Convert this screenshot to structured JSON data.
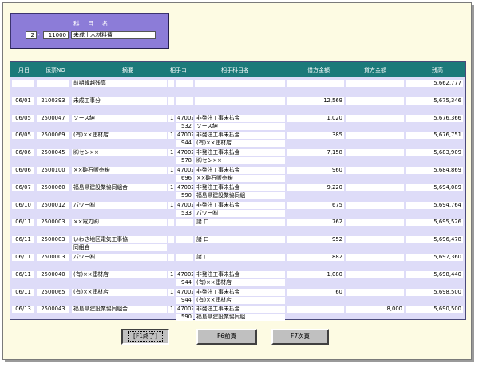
{
  "account": {
    "title": "科 目 名",
    "code1": "2",
    "code2": "11000",
    "name": "未成土木材料費"
  },
  "columns": {
    "date": "月日",
    "slip": "伝票NO",
    "summary": "摘要",
    "counter_code": "相手コ",
    "counter_name": "相手科目名",
    "debit": "借方金額",
    "credit": "貸方金額",
    "balance": "残高"
  },
  "rows": [
    {
      "date": "",
      "slip": "",
      "summary": "前期繰越残高",
      "summary2": "",
      "num": "",
      "code": "",
      "code2": "",
      "name": "",
      "name2": "",
      "debit": "",
      "credit": "",
      "balance": "5,662,777"
    },
    {
      "date": "06/01",
      "slip": "2100393",
      "summary": "未成工事分",
      "summary2": "",
      "num": "",
      "code": "",
      "code2": "",
      "name": "",
      "name2": "",
      "debit": "12,569",
      "credit": "",
      "balance": "5,675,346"
    },
    {
      "date": "06/05",
      "slip": "2500047",
      "summary": "ソース紳",
      "summary2": "",
      "num": "1",
      "code": "47002",
      "code2": "532",
      "name": "非発注工事未払金",
      "name2": "ソース紳",
      "debit": "1,020",
      "credit": "",
      "balance": "5,676,366"
    },
    {
      "date": "06/05",
      "slip": "2500069",
      "summary": "(有)××建材店",
      "summary2": "",
      "num": "1",
      "code": "47002",
      "code2": "944",
      "name": "非発注工事未払金",
      "name2": "(有)××建材店",
      "debit": "385",
      "credit": "",
      "balance": "5,676,751"
    },
    {
      "date": "06/06",
      "slip": "2500045",
      "summary": "㈱セン××",
      "summary2": "",
      "num": "1",
      "code": "47002",
      "code2": "578",
      "name": "非発注工事未払金",
      "name2": "㈱セン××",
      "debit": "7,158",
      "credit": "",
      "balance": "5,683,909"
    },
    {
      "date": "06/06",
      "slip": "2500100",
      "summary": "××砕石販売㈱",
      "summary2": "",
      "num": "1",
      "code": "47002",
      "code2": "696",
      "name": "非発注工事未払金",
      "name2": "××砕石販売㈱",
      "debit": "960",
      "credit": "",
      "balance": "5,684,869"
    },
    {
      "date": "06/07",
      "slip": "2500060",
      "summary": "福島県建設業協同組合",
      "summary2": "",
      "num": "1",
      "code": "47002",
      "code2": "590",
      "name": "非発注工事未払金",
      "name2": "福島県建設業協同組",
      "debit": "9,220",
      "credit": "",
      "balance": "5,694,089"
    },
    {
      "date": "06/10",
      "slip": "2500012",
      "summary": "パワー㈱",
      "summary2": "",
      "num": "1",
      "code": "47002",
      "code2": "533",
      "name": "非発注工事未払金",
      "name2": "パワー㈱",
      "debit": "675",
      "credit": "",
      "balance": "5,694,764"
    },
    {
      "date": "06/11",
      "slip": "2500003",
      "summary": "××電力㈱",
      "summary2": "",
      "num": "",
      "code": "",
      "code2": "",
      "name": "諸 口",
      "name2": "",
      "debit": "762",
      "credit": "",
      "balance": "5,695,526"
    },
    {
      "date": "06/11",
      "slip": "2500003",
      "summary": "いわき地区電気工事協",
      "summary2": "同組合",
      "num": "",
      "code": "",
      "code2": "",
      "name": "諸 口",
      "name2": "",
      "debit": "952",
      "credit": "",
      "balance": "5,696,478"
    },
    {
      "date": "06/11",
      "slip": "2500003",
      "summary": "パワー㈱",
      "summary2": "",
      "num": "",
      "code": "",
      "code2": "",
      "name": "諸 口",
      "name2": "",
      "debit": "882",
      "credit": "",
      "balance": "5,697,360"
    },
    {
      "date": "06/11",
      "slip": "2500040",
      "summary": "(有)××建材店",
      "summary2": "",
      "num": "1",
      "code": "47002",
      "code2": "944",
      "name": "非発注工事未払金",
      "name2": "(有)××建材店",
      "debit": "1,080",
      "credit": "",
      "balance": "5,698,440"
    },
    {
      "date": "06/11",
      "slip": "2500065",
      "summary": "(有)××建材店",
      "summary2": "",
      "num": "1",
      "code": "47002",
      "code2": "944",
      "name": "非発注工事未払金",
      "name2": "(有)××建材店",
      "debit": "60",
      "credit": "",
      "balance": "5,698,500"
    },
    {
      "date": "06/13",
      "slip": "2500043",
      "summary": "福島県建設業協同組合",
      "summary2": "",
      "num": "1",
      "code": "47002",
      "code2": "590",
      "name": "非発注工事未払金",
      "name2": "福島県建設業協同組",
      "debit": "",
      "credit": "8,000",
      "balance": "5,690,500"
    }
  ],
  "buttons": {
    "f1": "[F1終了]",
    "f6": "F6前頁",
    "f7": "F7次頁"
  }
}
